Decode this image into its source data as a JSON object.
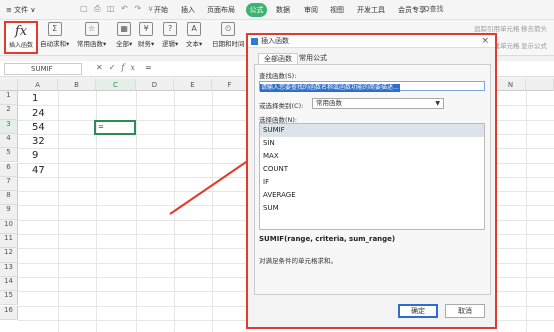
{
  "menubar": {
    "file_label": "≡ 文件 ∨",
    "tabs": [
      "开始",
      "插入",
      "页面布局",
      "公式",
      "数据",
      "审阅",
      "视图",
      "开发工具",
      "会员专享"
    ],
    "active_tab": "公式",
    "search_label": "Q查找"
  },
  "ribbon": {
    "insert_function": {
      "icon": "fx",
      "label": "插入函数"
    },
    "buttons": [
      {
        "glyph": "Σ",
        "label": "自动求和▾"
      },
      {
        "glyph": "☆",
        "label": "常用函数▾"
      },
      {
        "glyph": "▦",
        "label": "全部▾"
      },
      {
        "glyph": "¥",
        "label": "财务▾"
      },
      {
        "glyph": "?",
        "label": "逻辑▾"
      },
      {
        "glyph": "A",
        "label": "文本▾"
      },
      {
        "glyph": "⏲",
        "label": "日期和时间"
      }
    ],
    "right_items": [
      "追踪引用单元格",
      "移去箭头",
      "追踪从属单元格",
      "显示公式"
    ]
  },
  "formula_bar": {
    "name_box": "SUMIF",
    "cancel": "✕",
    "confirm": "✓",
    "fx": "fx",
    "content": "="
  },
  "sheet": {
    "columns": [
      "A",
      "B",
      "C",
      "D",
      "E",
      "F",
      "G",
      "H",
      "I",
      "J",
      "K",
      "L",
      "M",
      "N"
    ],
    "rows": [
      "1",
      "2",
      "3",
      "4",
      "5",
      "6",
      "7",
      "8",
      "9",
      "10",
      "11",
      "12",
      "13",
      "14",
      "15",
      "16"
    ],
    "values": [
      "1",
      "24",
      "54",
      "32",
      "9",
      "47"
    ],
    "active_cell_content": "="
  },
  "dialog": {
    "title": "插入函数",
    "close": "×",
    "tabs": [
      "全部函数",
      "常用公式"
    ],
    "search_label": "查找函数(S):",
    "search_placeholder": "请输入您要查找的函数名称或函数功能的简要描述...",
    "category_label": "或选择类别(C):",
    "category_value": "常用函数",
    "list_label": "选择函数(N):",
    "functions": [
      "SUMIF",
      "SIN",
      "MAX",
      "COUNT",
      "IF",
      "AVERAGE",
      "SUM"
    ],
    "selected_function": "SUMIF",
    "syntax": "SUMIF(range, criteria, sum_range)",
    "description": "对满足条件的单元格求和。",
    "ok": "确定",
    "cancel": "取消"
  },
  "colors": {
    "accent": "#3cb371",
    "highlight": "#e23b2e",
    "selection": "#2e6ecb"
  }
}
